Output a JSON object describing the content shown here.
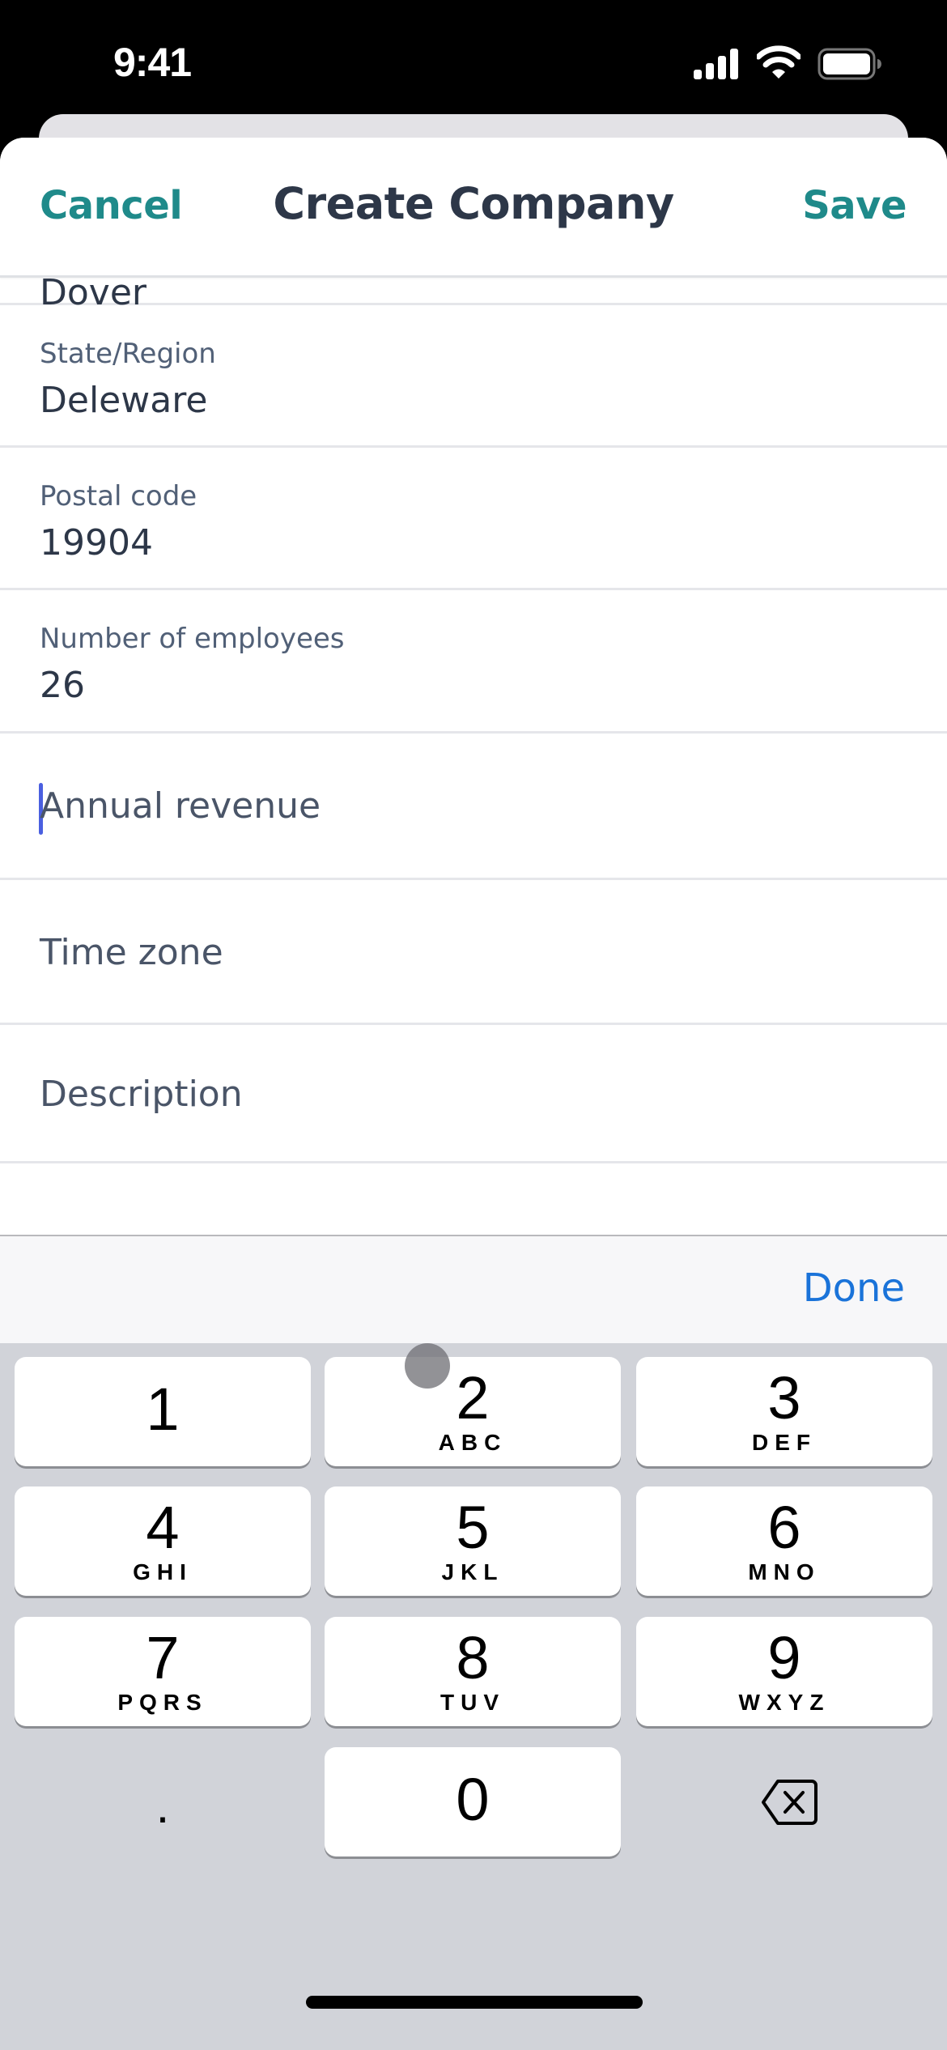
{
  "status_bar": {
    "time": "9:41",
    "icons": [
      "signal-icon",
      "wifi-icon",
      "battery-icon"
    ]
  },
  "header": {
    "cancel_label": "Cancel",
    "title": "Create Company",
    "save_label": "Save"
  },
  "form": {
    "rows": [
      {
        "label": "",
        "value": "Dover"
      },
      {
        "label": "State/Region",
        "value": "Deleware"
      },
      {
        "label": "Postal code",
        "value": "19904"
      },
      {
        "label": "Number of employees",
        "value": "26"
      },
      {
        "placeholder": "Annual revenue",
        "focused": true
      },
      {
        "placeholder": "Time zone"
      },
      {
        "placeholder": "Description"
      }
    ]
  },
  "toolbar": {
    "done_label": "Done"
  },
  "keyboard": {
    "keys": [
      {
        "num": "1",
        "letters": ""
      },
      {
        "num": "2",
        "letters": "ABC"
      },
      {
        "num": "3",
        "letters": "DEF"
      },
      {
        "num": "4",
        "letters": "GHI"
      },
      {
        "num": "5",
        "letters": "JKL"
      },
      {
        "num": "6",
        "letters": "MNO"
      },
      {
        "num": "7",
        "letters": "PQRS"
      },
      {
        "num": "8",
        "letters": "TUV"
      },
      {
        "num": "9",
        "letters": "WXYZ"
      },
      {
        "num": "0",
        "letters": ""
      }
    ],
    "decimal": ".",
    "delete_icon": "delete-backspace-icon"
  },
  "colors": {
    "accent_teal": "#1f8a8a",
    "done_blue": "#1a73d9",
    "cursor": "#4a5fe0",
    "text_dark": "#2d3748",
    "label": "#516077"
  }
}
